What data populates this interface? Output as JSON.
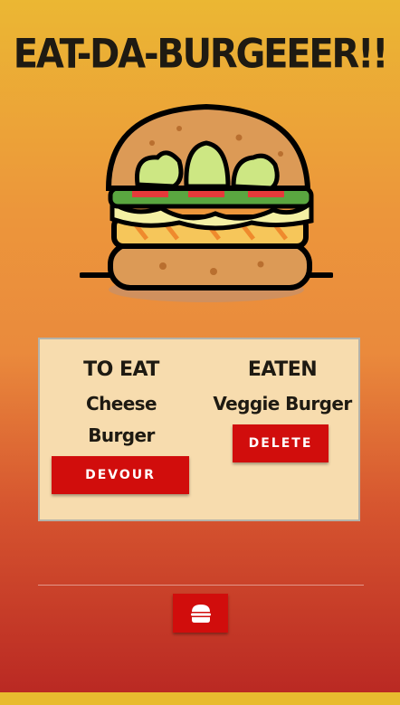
{
  "header": {
    "title": "EAT-DA-BURGEEER!!"
  },
  "logo": {
    "icon": "burger-illustration"
  },
  "panel": {
    "to_eat": {
      "title": "TO EAT",
      "items": [
        {
          "name": "Cheese Burger",
          "action_label": "DEVOUR"
        }
      ]
    },
    "eaten": {
      "title": "EATEN",
      "items": [
        {
          "name": "Veggie Burger",
          "action_label": "DELETE"
        }
      ]
    }
  },
  "footer": {
    "add_icon": "hamburger-icon"
  },
  "colors": {
    "background_top": "#ebb733",
    "background_bottom": "#b82622",
    "button": "#d10d0c",
    "panel": "#f7dcae",
    "title_text": "#1e1a12"
  }
}
